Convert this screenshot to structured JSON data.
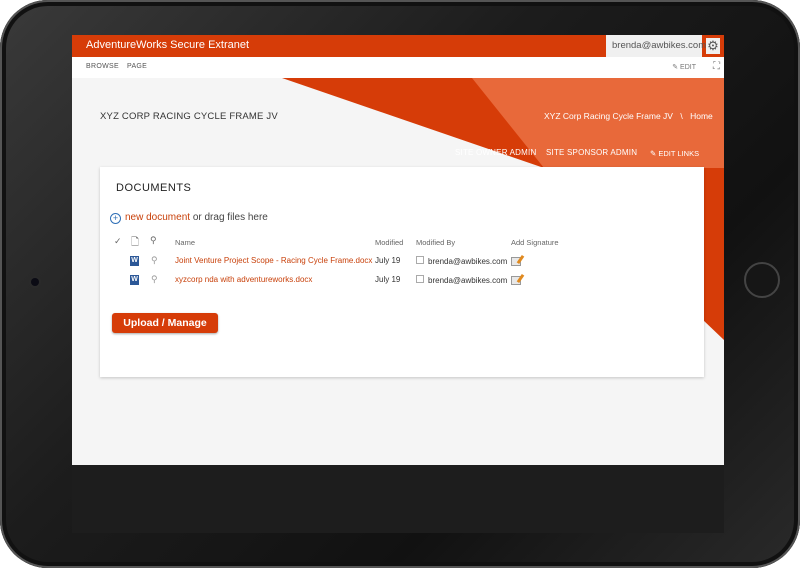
{
  "suitebar": {
    "title": "AdventureWorks Secure Extranet",
    "user": "brenda@awbikes.com",
    "gear_icon": "gear-icon"
  },
  "ribbon": {
    "browse": "BROWSE",
    "page": "PAGE",
    "edit": "EDIT"
  },
  "site": {
    "title": "XYZ CORP RACING CYCLE FRAME JV",
    "breadcrumb_site": "XYZ Corp Racing Cycle Frame JV",
    "breadcrumb_sep": "\\",
    "breadcrumb_home": "Home",
    "nav": [
      "SITE OWNER ADMIN",
      "SITE SPONSOR ADMIN"
    ],
    "edit_links": "EDIT LINKS"
  },
  "colors": {
    "accent": "#d63c08",
    "accent_light": "#e8693a",
    "link": "#c8410b"
  },
  "documents": {
    "heading": "DOCUMENTS",
    "new_document": "new document",
    "drag_text": " or drag files here",
    "columns": {
      "check": "✓",
      "name": "Name",
      "modified": "Modified",
      "modified_by": "Modified By",
      "add_signature": "Add Signature"
    },
    "rows": [
      {
        "name": "Joint Venture Project Scope - Racing Cycle Frame.docx",
        "modified": "July 19",
        "modified_by": "brenda@awbikes.com"
      },
      {
        "name": "xyzcorp nda with adventureworks.docx",
        "modified": "July 19",
        "modified_by": "brenda@awbikes.com"
      }
    ],
    "upload_label": "Upload / Manage"
  }
}
